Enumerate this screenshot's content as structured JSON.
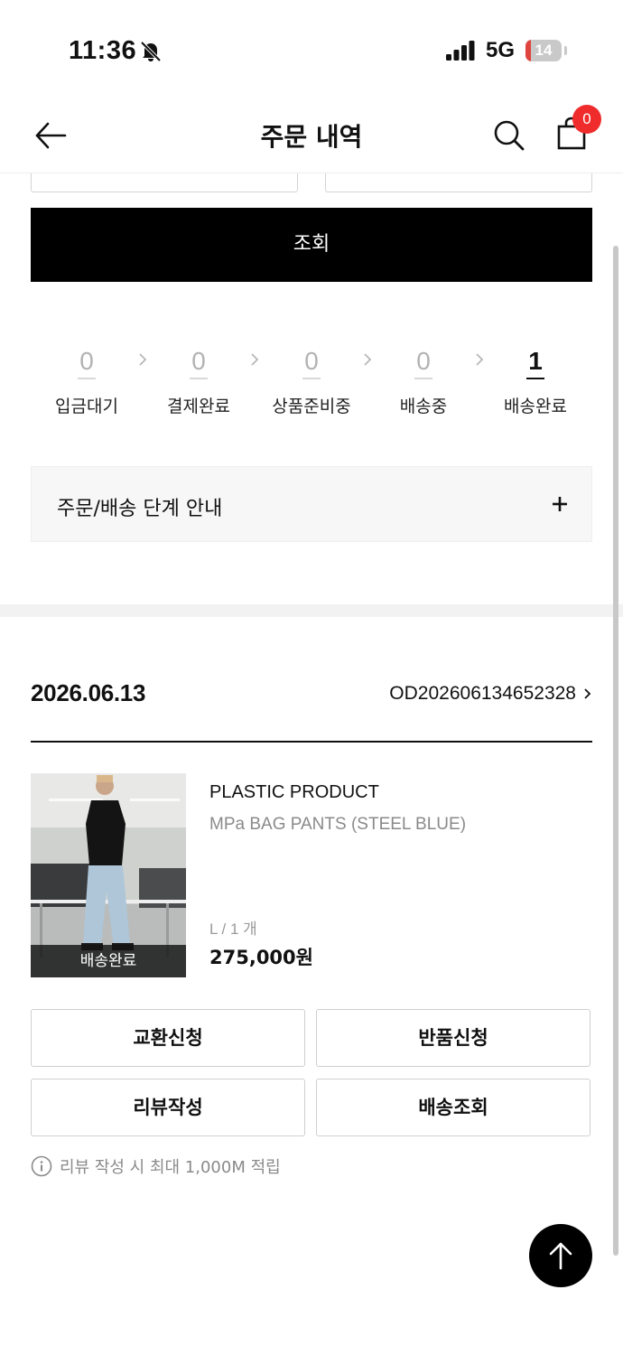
{
  "status_bar": {
    "time": "11:36",
    "network": "5G",
    "battery": "14",
    "battery_level_percent": 14,
    "bell_icon": "bell-slash-icon",
    "signal_icon": "signal-bars-icon"
  },
  "header": {
    "title": "주문 내역",
    "back_icon": "arrow-left-icon",
    "search_icon": "search-icon",
    "cart_icon": "shopping-bag-icon",
    "cart_badge": "0"
  },
  "search_button": "조회",
  "steps": [
    {
      "count": "0",
      "label": "입금대기",
      "active": false
    },
    {
      "count": "0",
      "label": "결제완료",
      "active": false
    },
    {
      "count": "0",
      "label": "상품준비중",
      "active": false
    },
    {
      "count": "0",
      "label": "배송중",
      "active": false
    },
    {
      "count": "1",
      "label": "배송완료",
      "active": true
    }
  ],
  "guide": {
    "label": "주문/배송 단계 안내",
    "toggle_icon": "plus-icon"
  },
  "order": {
    "date": "2026.06.13",
    "number": "OD202606134652328",
    "item": {
      "status": "배송완료",
      "brand": "PLASTIC PRODUCT",
      "name": "MPa BAG PANTS (STEEL BLUE)",
      "option": "L / 1 개",
      "price": "275,000원"
    },
    "actions": {
      "exchange": "교환신청",
      "return": "반품신청",
      "review": "리뷰작성",
      "tracking": "배송조회"
    },
    "note": "리뷰 작성 시 최대 1,000M 적립"
  },
  "colors": {
    "primary": "#000000",
    "badge": "#ef2b2b",
    "muted_text": "#8a8a8a"
  }
}
